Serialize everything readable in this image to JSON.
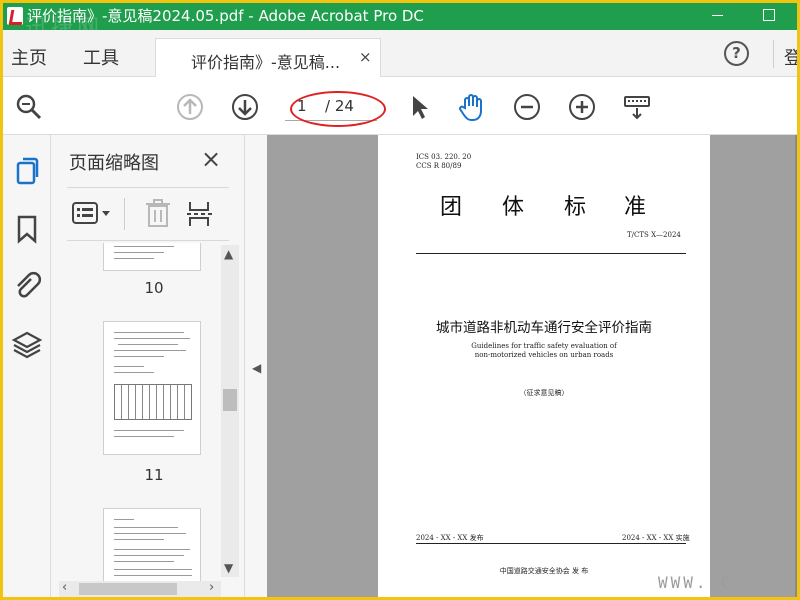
{
  "window": {
    "title": "评价指南》-意见稿2024.05.pdf - Adobe Acrobat Pro DC",
    "watermark_top": "迅捷网"
  },
  "menu": {
    "home": "主页",
    "tools": "工具",
    "doc_tab": "评价指南》-意见稿...",
    "tab_close": "×",
    "help": "?",
    "login": "登"
  },
  "toolbar": {
    "page_current": "1",
    "page_total": "/ 24"
  },
  "thumbnails": {
    "title": "页面缩略图",
    "close": "×",
    "pages": [
      {
        "number": "10"
      },
      {
        "number": "11"
      }
    ]
  },
  "document": {
    "ics": "ICS  03. 220. 20",
    "ccs": "CCS R 80/89",
    "title_chars": [
      "团",
      "体",
      "标",
      "准"
    ],
    "standard_no": "T/CTS X—2024",
    "title_cn": "城市道路非机动车通行安全评价指南",
    "title_en_line1": "Guidelines for traffic safety evaluation of",
    "title_en_line2": "non-motorized vehicles on urban roads",
    "draft_note": "（征求意见稿）",
    "release_date": "2024 - XX - XX 发布",
    "impl_date": "2024 - XX - XX 实施",
    "publisher": "中国道路交通安全协会     发  布"
  },
  "watermark_bottom": "WWW. C",
  "colors": {
    "titlebar": "#1f9e4d",
    "border": "#f1c40f",
    "accent_blue": "#1a73c9",
    "annotation_red": "#e02020"
  },
  "icons": [
    "zoom-icon",
    "page-up-icon",
    "page-down-icon",
    "select-cursor-icon",
    "hand-tool-icon",
    "zoom-out-icon",
    "zoom-in-icon",
    "keyboard-icon",
    "pages-icon",
    "bookmark-icon",
    "attachment-icon",
    "layers-icon",
    "options-icon",
    "delete-icon",
    "extract-icon"
  ]
}
